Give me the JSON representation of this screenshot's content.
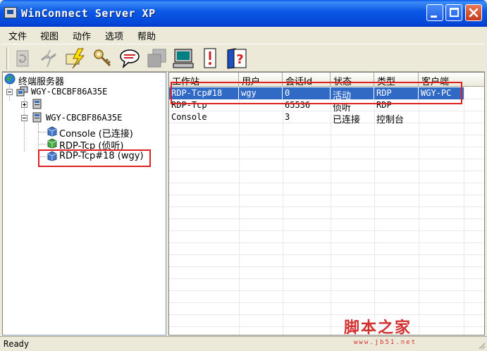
{
  "window": {
    "title": "WinConnect Server XP"
  },
  "menu": [
    {
      "label": "文件"
    },
    {
      "label": "视图"
    },
    {
      "label": "动作"
    },
    {
      "label": "选项"
    },
    {
      "label": "帮助"
    }
  ],
  "toolbar": {
    "icons": [
      "refresh-icon",
      "disconnect-icon",
      "connect-icon",
      "key-icon",
      "message-icon",
      "window-icon",
      "monitor-icon",
      "properties-icon",
      "help-icon"
    ]
  },
  "tree": {
    "root": "终端服务器",
    "server1": "WGY-CBCBF86A35E",
    "server2": "WGY-CBCBF86A35E",
    "sessions": [
      {
        "label": "Console (已连接)"
      },
      {
        "label": "RDP-Tcp (侦听)"
      },
      {
        "label": "RDP-Tcp#18 (wgy)"
      }
    ]
  },
  "list": {
    "columns": [
      "工作站",
      "用户",
      "会话Id",
      "状态",
      "类型",
      "客户端"
    ],
    "rows": [
      {
        "workstation": "RDP-Tcp#18",
        "user": "wgy",
        "session_id": "0",
        "state": "活动",
        "type": "RDP",
        "client": "WGY-PC",
        "selected": true
      },
      {
        "workstation": "RDP-Tcp",
        "user": "",
        "session_id": "65536",
        "state": "侦听",
        "type": "RDP",
        "client": ""
      },
      {
        "workstation": "Console",
        "user": "",
        "session_id": "3",
        "state": "已连接",
        "type": "控制台",
        "client": ""
      }
    ]
  },
  "status": {
    "text": "Ready"
  },
  "watermark": {
    "main": "脚本之家",
    "sub": "www.jb51.net"
  },
  "colors": {
    "selection": "#316ac5",
    "annotation": "#e02020",
    "titlebar": "#0a58ea"
  }
}
